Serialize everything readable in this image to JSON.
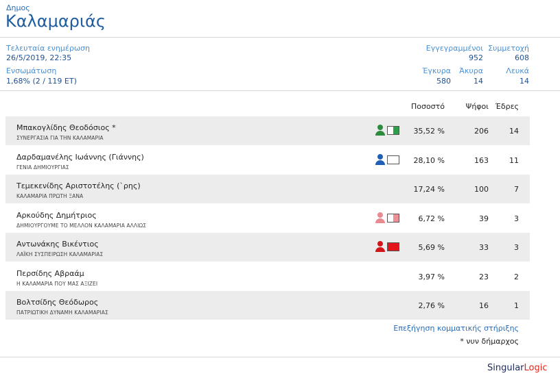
{
  "header": {
    "subtitle": "Δημος",
    "title": "Καλαμαριάς"
  },
  "stats": {
    "last_update_label": "Τελευταία ενημέρωση",
    "last_update_value": "26/5/2019, 22:35",
    "integration_label": "Ενσωμάτωση",
    "integration_value": "1,68% (2 / 119 ΕΤ)",
    "registered_label": "Εγγεγραμμένοι",
    "registered_value": "952",
    "turnout_label": "Συμμετοχή",
    "turnout_value": "608",
    "valid_label": "Έγκυρα",
    "valid_value": "580",
    "invalid_label": "Άκυρα",
    "invalid_value": "14",
    "blank_label": "Λευκά",
    "blank_value": "14"
  },
  "table": {
    "col_percent": "Ποσοστό",
    "col_votes": "Ψήφοι",
    "col_seats": "Έδρες",
    "rows": [
      {
        "name": "Μπακογλίδης Θεοδόσιος *",
        "party": "ΣΥΝΕΡΓΑΣΙΑ ΓΙΑ ΤΗΝ ΚΑΛΑΜΑΡΙΑ",
        "percent": "35,52 %",
        "votes": "206",
        "seats": "14",
        "support": {
          "person": "#2e8b3e",
          "flag_fill": "#2e9e48",
          "flag_split": 0.5
        }
      },
      {
        "name": "Δαρδαμανέλης Ιωάννης (Γιάννης)",
        "party": "ΓΕΝΙΑ ΔΗΜΙΟΥΡΓΙΑΣ",
        "percent": "28,10 %",
        "votes": "163",
        "seats": "11",
        "support": {
          "person": "#1f5fb4",
          "flag_fill": "#ffffff",
          "flag_split": 0
        }
      },
      {
        "name": "Τεμεκενίδης Αριστοτέλης (`ρης)",
        "party": "ΚΑΛΑΜΑΡΙΑ ΠΡΩΤΗ ΞΑΝΑ",
        "percent": "17,24 %",
        "votes": "100",
        "seats": "7",
        "support": null
      },
      {
        "name": "Αρκούδης Δημήτριος",
        "party": "ΔΗΜΙΟΥΡΓΟΥΜΕ ΤΟ ΜΕΛΛΟΝ ΚΑΛΑΜΑΡΙΑ ΑΛΛΙΩΣ",
        "percent": "6,72 %",
        "votes": "39",
        "seats": "3",
        "support": {
          "person": "#e88a90",
          "flag_fill": "#ee8f95",
          "flag_split": 0.5
        }
      },
      {
        "name": "Αντωνάκης Βικέντιος",
        "party": "ΛΑΪΚΗ ΣΥΣΠΕΙΡΩΣΗ ΚΑΛΑΜΑΡΙΑΣ",
        "percent": "5,69 %",
        "votes": "33",
        "seats": "3",
        "support": {
          "person": "#d0161a",
          "flag_fill": "#e3161b",
          "flag_split": 1
        }
      },
      {
        "name": "Περσίδης Αβραάμ",
        "party": "Η ΚΑΛΑΜΑΡΙΑ ΠΟΥ ΜΑΣ ΑΞΙΖΕΙ",
        "percent": "3,97 %",
        "votes": "23",
        "seats": "2",
        "support": null
      },
      {
        "name": "Βολτσίδης Θεόδωρος",
        "party": "ΠΑΤΡΙΩΤΙΚΗ ΔΥΝΑΜΗ ΚΑΛΑΜΑΡΙΑΣ",
        "percent": "2,76 %",
        "votes": "16",
        "seats": "1",
        "support": null
      }
    ]
  },
  "footer": {
    "link": "Επεξήγηση κομματικής στήριξης",
    "note": "* νυν δήμαρχος",
    "logo_part1": "Singular",
    "logo_part2": "Logic"
  },
  "colors": {
    "title": "#1f5d9e",
    "label": "#4a90d2",
    "row_shade": "#ececec",
    "logo_accent": "#e2231a"
  }
}
